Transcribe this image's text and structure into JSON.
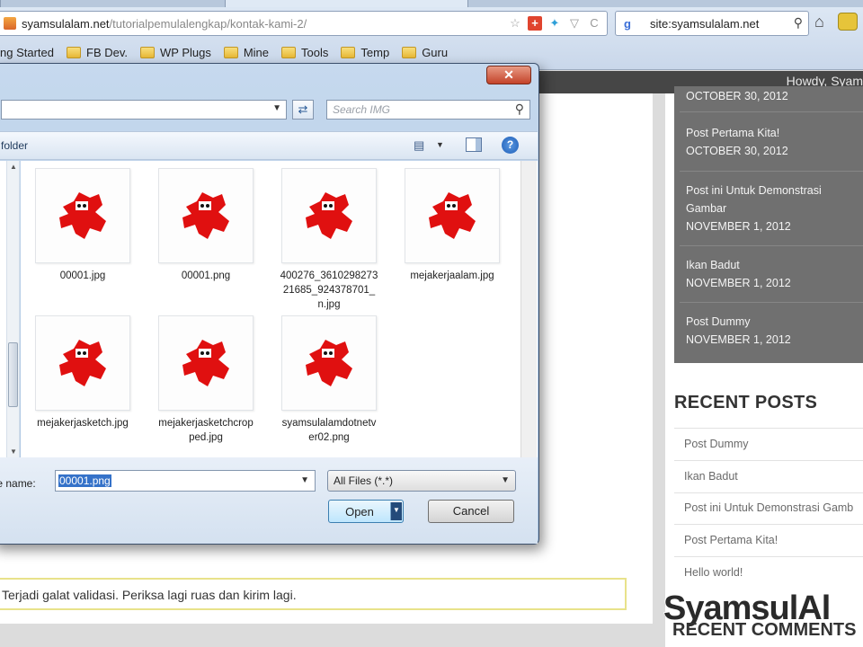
{
  "browser": {
    "url_domain": "syamsulalam.net",
    "url_path": "/tutorialpemulalengkap/kontak-kami-2/",
    "search_query": "site:syamsulalam.net",
    "bookmarks": [
      {
        "label": "ng Started"
      },
      {
        "label": "FB Dev."
      },
      {
        "label": "WP Plugs"
      },
      {
        "label": "Mine"
      },
      {
        "label": "Tools"
      },
      {
        "label": "Temp"
      },
      {
        "label": "Guru"
      }
    ]
  },
  "page": {
    "admin_greeting": "Howdy, Syam",
    "sidebar_posts": [
      {
        "title": "",
        "date": "OCTOBER 30, 2012"
      },
      {
        "title": "Post Pertama Kita!",
        "date": "OCTOBER 30, 2012"
      },
      {
        "title": "Post ini Untuk Demonstrasi Gambar",
        "date": "NOVEMBER 1, 2012"
      },
      {
        "title": "Ikan Badut",
        "date": "NOVEMBER 1, 2012"
      },
      {
        "title": "Post Dummy",
        "date": "NOVEMBER 1, 2012"
      }
    ],
    "recent_posts_heading": "RECENT POSTS",
    "recent_posts": [
      {
        "label": "Post Dummy"
      },
      {
        "label": "Ikan Badut"
      },
      {
        "label": "Post ini Untuk Demonstrasi Gamb"
      },
      {
        "label": "Post Pertama Kita!"
      },
      {
        "label": "Hello world!"
      }
    ],
    "validation_message": "Terjadi galat validasi. Periksa lagi ruas dan kirim lagi.",
    "watermark": "SyamsulAl",
    "recent_comments_heading": "RECENT COMMENTS"
  },
  "dialog": {
    "search_placeholder": "Search IMG",
    "toolbar_label": "folder",
    "files": [
      {
        "name": "00001.jpg"
      },
      {
        "name": "00001.png"
      },
      {
        "name": "400276_361029827321685_924378701_n.jpg"
      },
      {
        "name": "mejakerjaalam.jpg"
      },
      {
        "name": "mejakerjasketch.jpg"
      },
      {
        "name": "mejakerjasketchcropped.jpg"
      },
      {
        "name": "syamsulalamdotnetver02.png"
      }
    ],
    "file_name_label": "ile name:",
    "file_name_value": "00001.png",
    "filter_value": "All Files (*.*)",
    "open_label": "Open",
    "cancel_label": "Cancel"
  },
  "colors": {
    "thumbnail_icon": "#e01010",
    "selection": "#3572c9"
  }
}
